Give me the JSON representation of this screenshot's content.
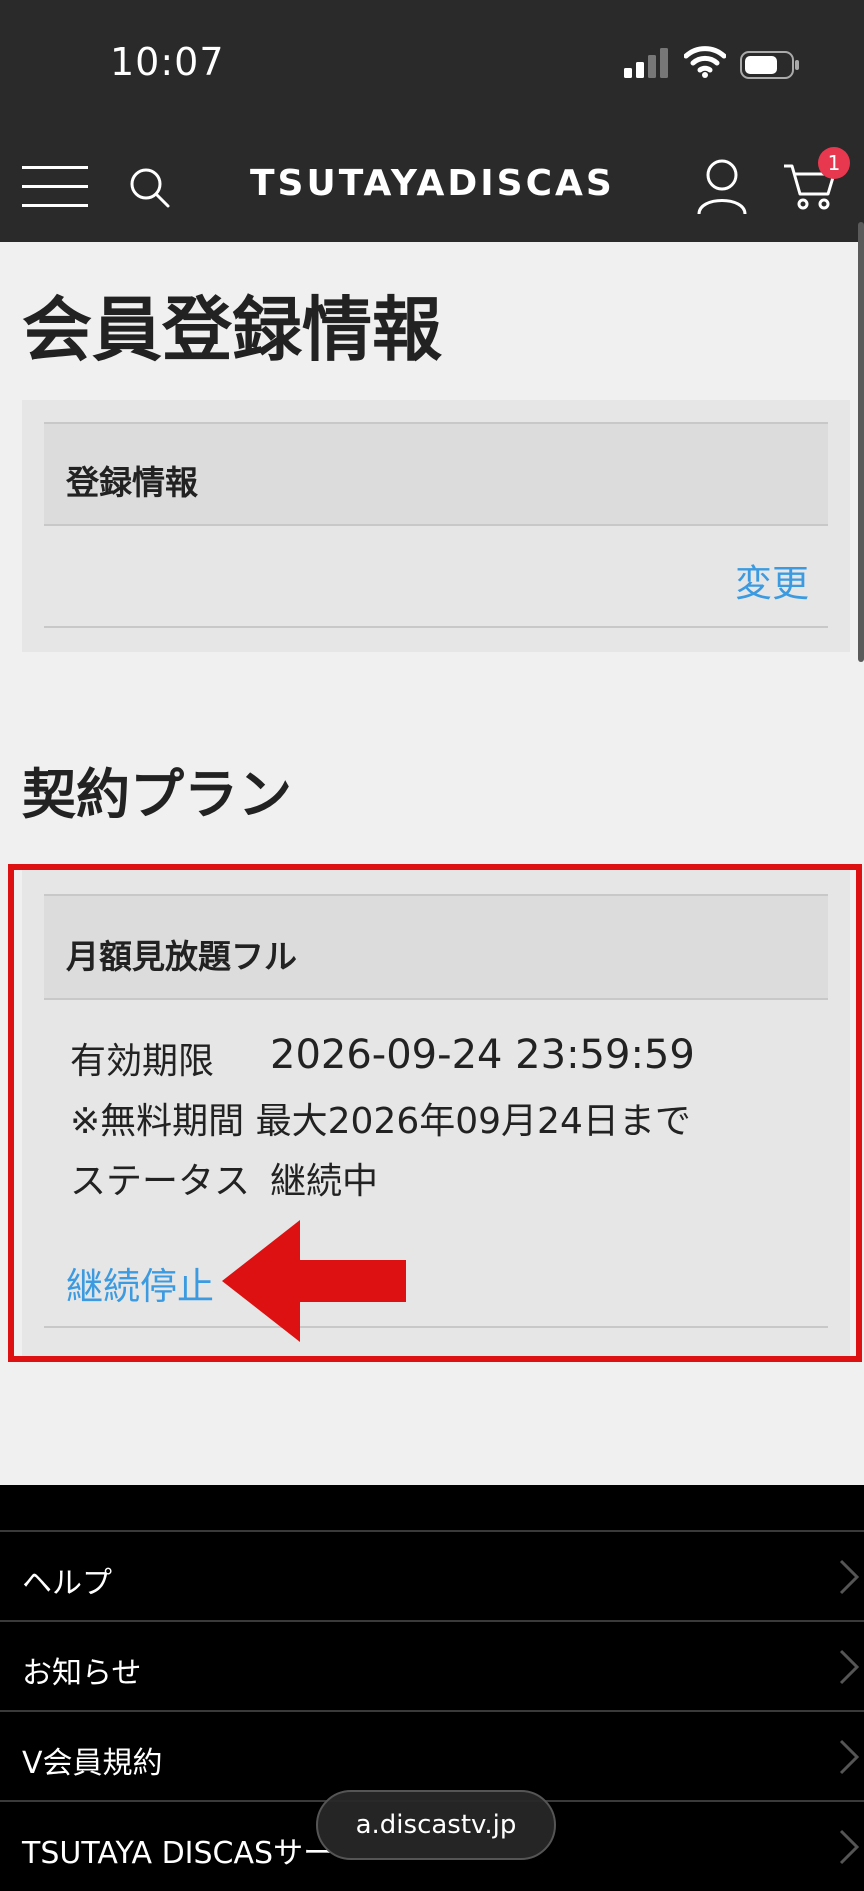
{
  "status_bar": {
    "time": "10:07"
  },
  "header": {
    "logo_text": "TSUTAYADISCAS",
    "cart_count": "1",
    "icons": [
      "menu-icon",
      "search-icon",
      "user-icon",
      "cart-icon"
    ],
    "colors": {
      "background": "#2a2a2a",
      "badge": "#e8384f"
    }
  },
  "page": {
    "title": "会員登録情報",
    "registration": {
      "header": "登録情報",
      "change_link": "変更"
    },
    "contract": {
      "section_title": "契約プラン",
      "plan_name": "月額見放題フル",
      "expiry_label": "有効期限",
      "expiry_value": "2026-09-24 23:59:59",
      "free_period": "※無料期間 最大2026年09月24日まで",
      "status_label": "ステータス",
      "status_value": "継続中",
      "stop_link": "継続停止"
    },
    "colors": {
      "link": "#3b9ae0",
      "highlight": "#dd1111"
    }
  },
  "footer": {
    "items": [
      {
        "label": "ヘルプ"
      },
      {
        "label": "お知らせ"
      },
      {
        "label": "V会員規約"
      },
      {
        "label": "TSUTAYA DISCASサー"
      }
    ]
  },
  "browser": {
    "url": "a.discastv.jp"
  }
}
